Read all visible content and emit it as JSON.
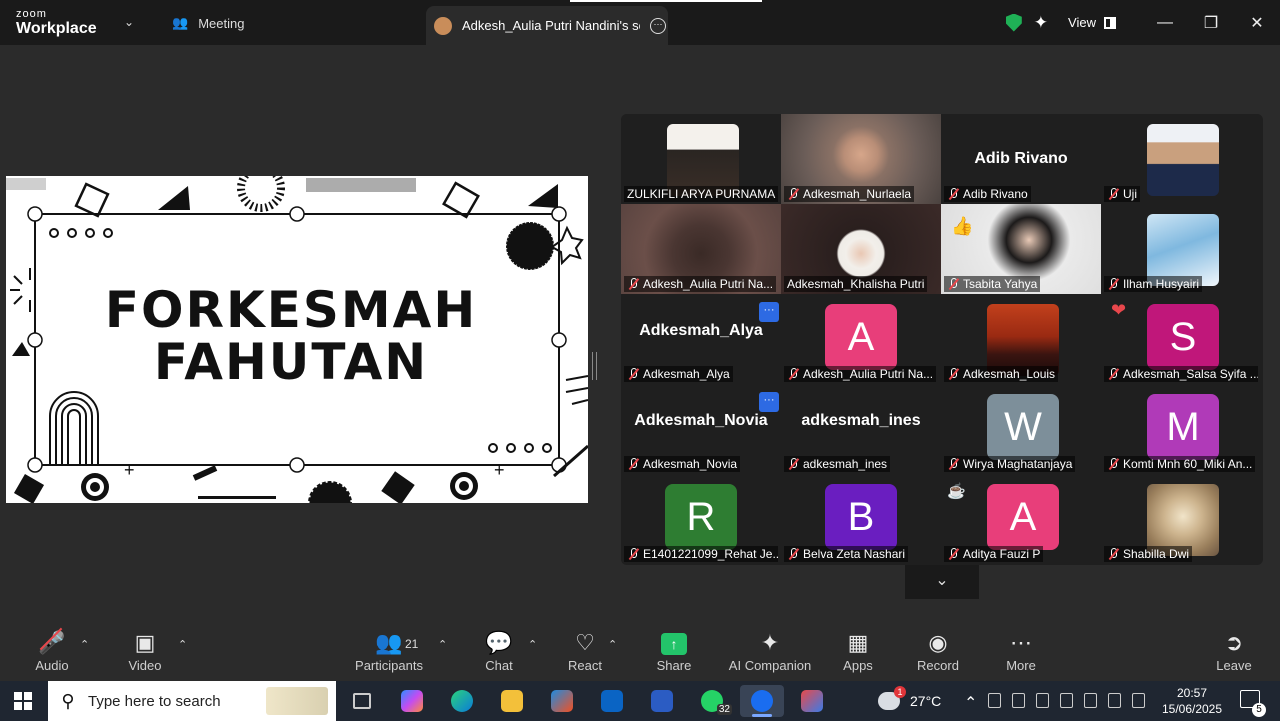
{
  "app": {
    "logo_top": "zoom",
    "logo_bottom": "Workplace"
  },
  "tabs": {
    "meeting": "Meeting",
    "share": "Adkesh_Aulia Putri Nandini's scree"
  },
  "window": {
    "view_label": "View"
  },
  "shared_screen": {
    "line1": "FORKESMAH",
    "line2": "FAHUTAN"
  },
  "gallery": {
    "tiles": [
      {
        "name": "ZULKIFLI ARYA PURNAMA",
        "muted": false
      },
      {
        "name": "Adkesmah_Nurlaela",
        "muted": true
      },
      {
        "name": "Adib Rivano",
        "muted": true,
        "big": "Adib Rivano"
      },
      {
        "name": "Uji",
        "muted": true
      },
      {
        "name": "Adkesh_Aulia Putri Na...",
        "muted": true
      },
      {
        "name": "Adkesmah_Khalisha Putri",
        "muted": false
      },
      {
        "name": "Tsabita Yahya",
        "muted": true
      },
      {
        "name": "Ilham Husyairi",
        "muted": true
      },
      {
        "name": "Adkesmah_Alya",
        "muted": true,
        "big": "Adkesmah_Alya"
      },
      {
        "name": "Adkesh_Aulia Putri Na...",
        "muted": true,
        "initial": "A"
      },
      {
        "name": "Adkesmah_Louis",
        "muted": true
      },
      {
        "name": "Adkesmah_Salsa Syifa ...",
        "muted": true,
        "initial": "S"
      },
      {
        "name": "Adkesmah_Novia",
        "muted": true,
        "big": "Adkesmah_Novia"
      },
      {
        "name": "adkesmah_ines",
        "muted": true,
        "big": "adkesmah_ines"
      },
      {
        "name": "Wirya Maghatanjaya",
        "muted": true,
        "initial": "W"
      },
      {
        "name": "Komti Mnh 60_Miki An...",
        "muted": true,
        "initial": "M"
      },
      {
        "name": "E1401221099_Rehat Je...",
        "muted": true,
        "initial": "R"
      },
      {
        "name": "Belva Zeta Nashari",
        "muted": true,
        "initial": "B"
      },
      {
        "name": "Aditya Fauzi P",
        "muted": true,
        "initial": "A"
      },
      {
        "name": "Shabilla Dwi",
        "muted": true
      }
    ],
    "colors": {
      "active_border": "#29c36a",
      "pink": "#e83e7a",
      "magenta": "#c0177a",
      "purple": "#b03ab8",
      "steel": "#7d8f9a",
      "green": "#2e7d32",
      "violet": "#6a1ec0"
    }
  },
  "toolbar": {
    "audio": "Audio",
    "video": "Video",
    "participants": "Participants",
    "participants_count": "21",
    "chat": "Chat",
    "react": "React",
    "share": "Share",
    "ai_companion": "AI Companion",
    "apps": "Apps",
    "record": "Record",
    "more": "More",
    "leave": "Leave"
  },
  "taskbar": {
    "search_placeholder": "Type here to search",
    "whatsapp_count": "32",
    "temperature": "27°C",
    "time": "20:57",
    "date": "15/06/2025",
    "notifications": "5"
  }
}
